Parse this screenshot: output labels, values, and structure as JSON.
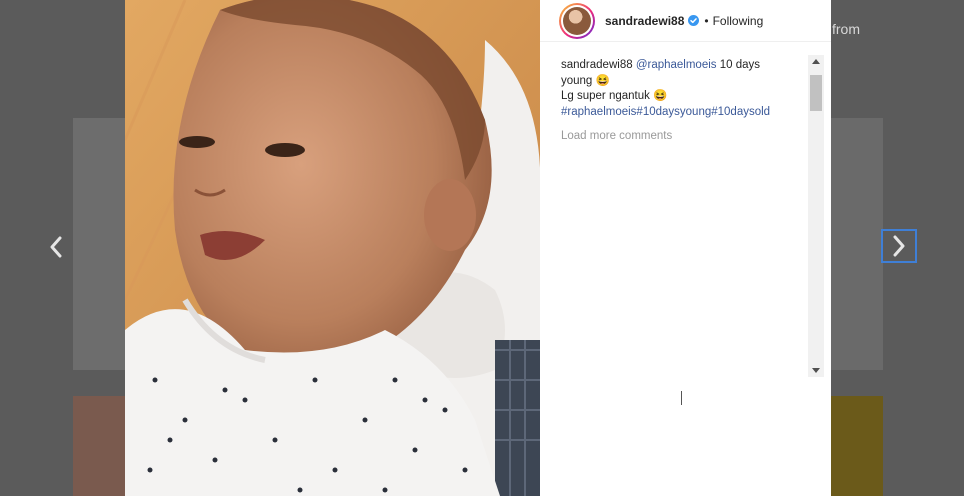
{
  "background": {
    "side_text": "from"
  },
  "nav": {
    "prev_icon": "chevron-left-icon",
    "next_icon": "chevron-right-icon",
    "next_border": "#3f7fd6"
  },
  "post": {
    "username": "sandradewi88",
    "verified_icon": "verified-badge-icon",
    "separator": "•",
    "follow_label": "Following",
    "caption": {
      "username": "sandradewi88",
      "mention": "@raphaelmoeis",
      "text_line1": " 10 days young 😆",
      "text_line2": "Lg super ngantuk 😆",
      "hashtags": "#raphaelmoeis#10daysyoung#10daysold"
    },
    "load_more": "Load more comments"
  },
  "colors": {
    "link": "#3b5998",
    "text": "#262626",
    "muted": "#999999"
  }
}
